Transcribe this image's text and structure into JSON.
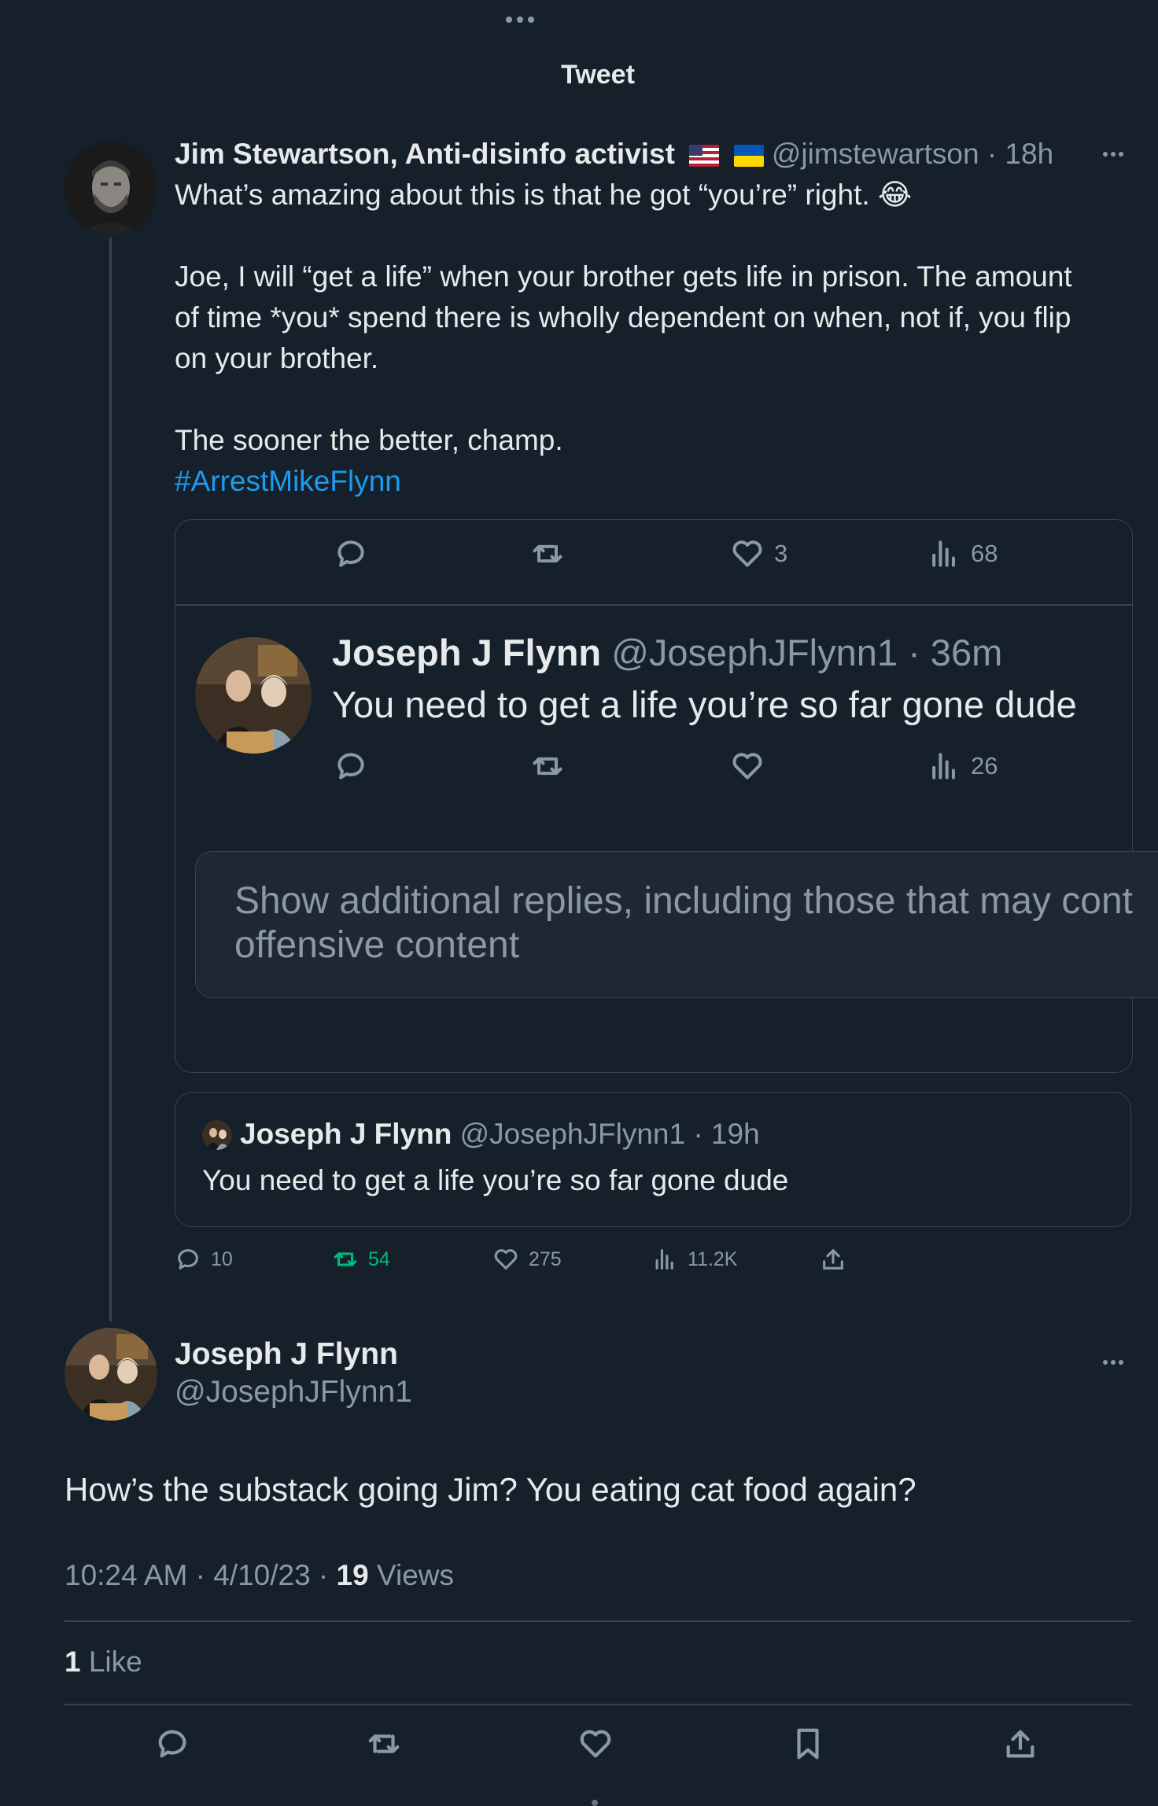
{
  "header": {
    "title": "Tweet"
  },
  "jim_tweet": {
    "author_name": "Jim Stewartson, Anti-disinfo activist",
    "flags": [
      "us-flag",
      "ukraine-flag"
    ],
    "handle_time": "@jimstewartson · 18h",
    "line1": "What’s amazing about this is that he got “you’re” right. 😂",
    "line2": "Joe, I will “get a life” when your brother gets life in prison. The amount",
    "line3": "of time *you* spend there is wholly dependent on when, not if, you flip",
    "line4": "on your brother.",
    "line5": "The sooner the better, champ.",
    "hashtag": "#ArrestMikeFlynn",
    "actions": {
      "replies": "10",
      "retweets": "54",
      "likes": "275",
      "views": "11.2K"
    }
  },
  "embedded_card": {
    "top_actions": {
      "likes": "3",
      "views": "68"
    },
    "reply": {
      "author_name": "Joseph J Flynn",
      "handle_time": "@JosephJFlynn1 · 36m",
      "text": "You need to get a life you’re so far gone dude",
      "views": "26"
    },
    "additional_replies_line1": "Show additional replies, including those that may cont",
    "additional_replies_line2": "offensive content"
  },
  "quoted_tweet": {
    "author_name": "Joseph J Flynn",
    "handle_time": "@JosephJFlynn1 · 19h",
    "text": "You need to get a life you’re so far gone dude"
  },
  "main_tweet": {
    "author_name": "Joseph J Flynn",
    "handle": "@JosephJFlynn1",
    "text": "How’s the substack going Jim?  You eating cat food again?",
    "time_date": "10:24 AM · 4/10/23 · ",
    "views_count": "19",
    "views_label": " Views",
    "likes_count": "1",
    "likes_label": " Like"
  },
  "colors": {
    "background": "#15202b",
    "accent": "#1d9bf0",
    "retweet_green": "#00ba7c",
    "muted": "#8b98a5"
  }
}
